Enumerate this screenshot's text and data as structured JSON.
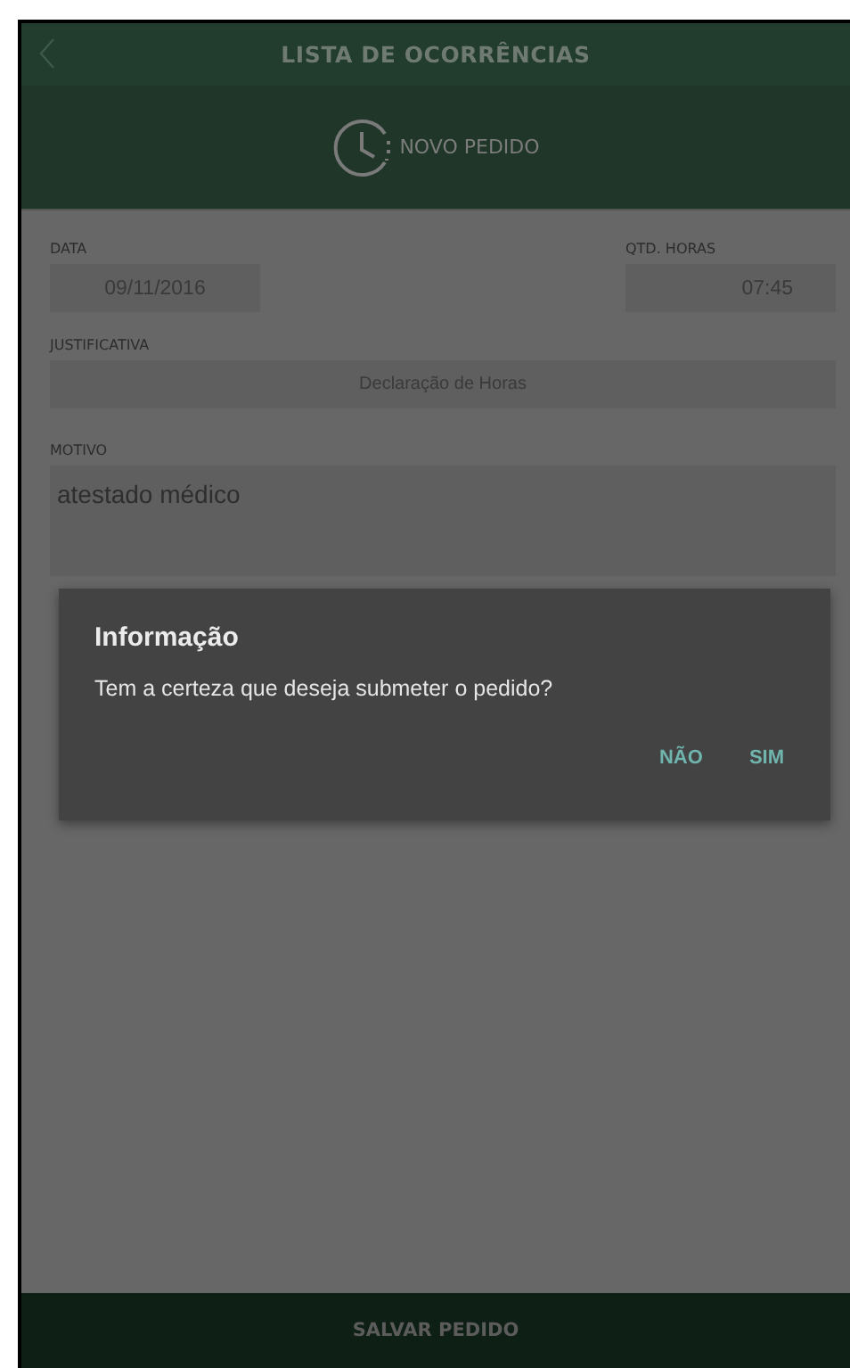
{
  "header": {
    "title": "LISTA DE OCORRÊNCIAS"
  },
  "subheader": {
    "title": "NOVO PEDIDO"
  },
  "form": {
    "date": {
      "label": "DATA",
      "value": "09/11/2016"
    },
    "hours": {
      "label": "QTD. HORAS",
      "value": "07:45"
    },
    "justification": {
      "label": "JUSTIFICATIVA",
      "value": "Declaração de Horas"
    },
    "reason": {
      "label": "MOTIVO",
      "value": "atestado médico"
    }
  },
  "dialog": {
    "title": "Informação",
    "message": "Tem a certeza que deseja submeter o pedido?",
    "buttons": [
      "NÃO",
      "SIM"
    ]
  },
  "footer": {
    "button": "SALVAR PEDIDO"
  }
}
